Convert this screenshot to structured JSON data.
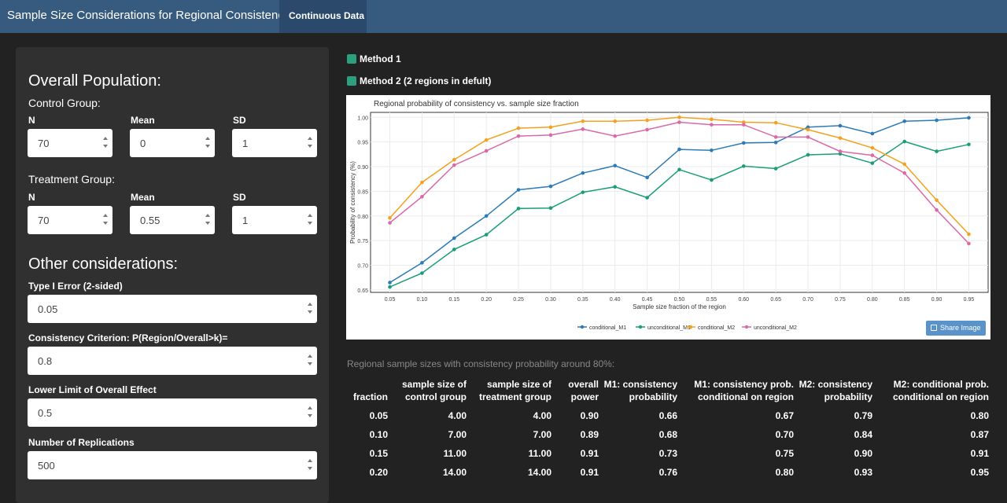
{
  "nav": {
    "title": "Sample Size Considerations for Regional Consistency",
    "tab": "Continuous Data"
  },
  "sidebar": {
    "overall_heading": "Overall Population:",
    "control_label": "Control Group:",
    "treatment_label": "Treatment Group:",
    "n_label": "N",
    "mean_label": "Mean",
    "sd_label": "SD",
    "control": {
      "n": "70",
      "mean": "0",
      "sd": "1"
    },
    "treatment": {
      "n": "70",
      "mean": "0.55",
      "sd": "1"
    },
    "other_heading": "Other considerations:",
    "type1_label": "Type I Error (2-sided)",
    "type1_value": "0.05",
    "criterion_label": "Consistency Criterion: P(Region/Overall>k)=",
    "criterion_value": "0.8",
    "lower_label": "Lower Limit of Overall Effect",
    "lower_value": "0.5",
    "reps_label": "Number of Replications",
    "reps_value": "500"
  },
  "methods": {
    "m1": "Method 1",
    "m2": "Method 2 (2 regions in defult)",
    "color": "#2ca07e"
  },
  "share_label": "Share Image",
  "chart_data": {
    "type": "line",
    "title": "Regional probability of consistency vs. sample size fraction",
    "xlabel": "Sample size fraction of the region",
    "ylabel": "Probability of consistency (%)",
    "ylim": [
      0.645,
      1.01
    ],
    "categories": [
      "0.05",
      "0.10",
      "0.15",
      "0.20",
      "0.25",
      "0.30",
      "0.35",
      "0.40",
      "0.45",
      "0.50",
      "0.55",
      "0.60",
      "0.65",
      "0.70",
      "0.75",
      "0.80",
      "0.85",
      "0.90",
      "0.95"
    ],
    "yticks": [
      "0.65",
      "0.70",
      "0.75",
      "0.80",
      "0.85",
      "0.90",
      "0.95",
      "1.00"
    ],
    "legend": "bottom",
    "series": [
      {
        "name": "conditional_M1",
        "color": "#2c7bb6",
        "values": [
          0.665,
          0.705,
          0.755,
          0.8,
          0.853,
          0.86,
          0.887,
          0.902,
          0.878,
          0.935,
          0.933,
          0.948,
          0.949,
          0.98,
          0.983,
          0.967,
          0.992,
          0.994,
          0.999
        ]
      },
      {
        "name": "unconditional_M1",
        "color": "#1a9e77",
        "values": [
          0.656,
          0.684,
          0.732,
          0.762,
          0.815,
          0.816,
          0.848,
          0.859,
          0.837,
          0.894,
          0.873,
          0.901,
          0.896,
          0.924,
          0.926,
          0.907,
          0.951,
          0.931,
          0.945
        ]
      },
      {
        "name": "conditional_M2",
        "color": "#f4a11f",
        "values": [
          0.796,
          0.868,
          0.914,
          0.954,
          0.978,
          0.98,
          0.992,
          0.992,
          0.994,
          1.0,
          0.996,
          0.99,
          0.989,
          0.975,
          0.958,
          0.938,
          0.905,
          0.832,
          0.763
        ]
      },
      {
        "name": "unconditional_M2",
        "color": "#d96aa8",
        "values": [
          0.786,
          0.839,
          0.903,
          0.932,
          0.962,
          0.964,
          0.976,
          0.962,
          0.975,
          0.99,
          0.985,
          0.985,
          0.96,
          0.96,
          0.931,
          0.923,
          0.887,
          0.812,
          0.744
        ]
      }
    ]
  },
  "table": {
    "caption": "Regional sample sizes with consistency probability around 80%:",
    "headers": [
      "fraction",
      "sample size of control group",
      "sample size of treatment group",
      "overall power",
      "M1: consistency probability",
      "M1: consistency prob. conditional on region",
      "M2: consistency probability",
      "M2: conditional prob. conditional on region"
    ],
    "rows": [
      [
        "0.05",
        "4.00",
        "4.00",
        "0.90",
        "0.66",
        "0.67",
        "0.79",
        "0.80"
      ],
      [
        "0.10",
        "7.00",
        "7.00",
        "0.89",
        "0.68",
        "0.70",
        "0.84",
        "0.87"
      ],
      [
        "0.15",
        "11.00",
        "11.00",
        "0.91",
        "0.73",
        "0.75",
        "0.90",
        "0.91"
      ],
      [
        "0.20",
        "14.00",
        "14.00",
        "0.91",
        "0.76",
        "0.80",
        "0.93",
        "0.95"
      ]
    ]
  }
}
